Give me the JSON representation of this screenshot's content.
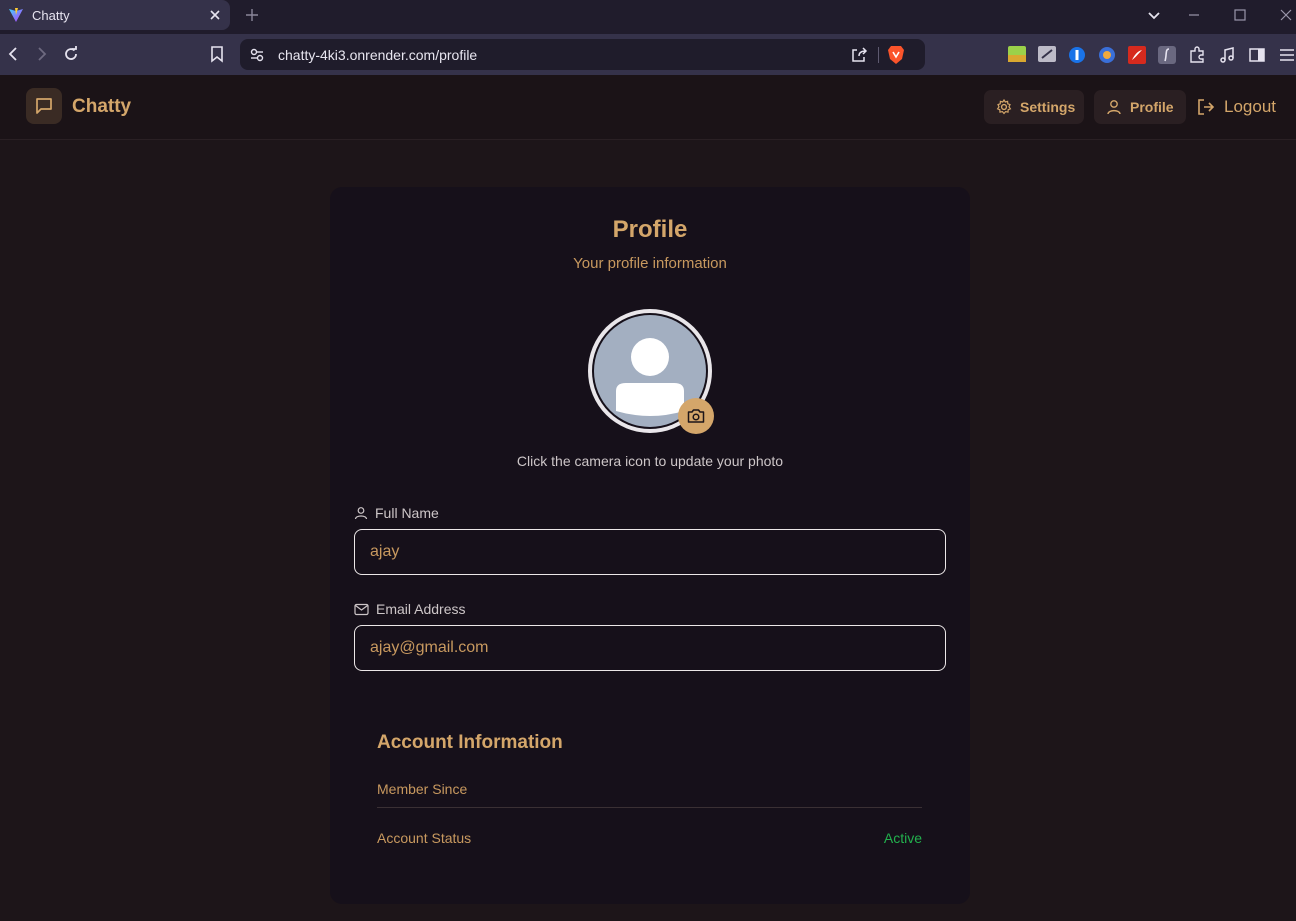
{
  "browser": {
    "tab_title": "Chatty",
    "url": "chatty-4ki3.onrender.com/profile"
  },
  "header": {
    "app_name": "Chatty",
    "settings_label": "Settings",
    "profile_label": "Profile",
    "logout_label": "Logout"
  },
  "profile": {
    "title": "Profile",
    "subtitle": "Your profile information",
    "avatar_hint": "Click the camera icon to update your photo",
    "full_name_label": "Full Name",
    "full_name_value": "ajay",
    "email_label": "Email Address",
    "email_value": "ajay@gmail.com"
  },
  "account": {
    "title": "Account Information",
    "member_since_label": "Member Since",
    "member_since_value": "",
    "status_label": "Account Status",
    "status_value": "Active"
  },
  "colors": {
    "accent": "#d4a66a",
    "background": "#1d1519",
    "card": "#16101a",
    "status_active": "#22b04d"
  }
}
